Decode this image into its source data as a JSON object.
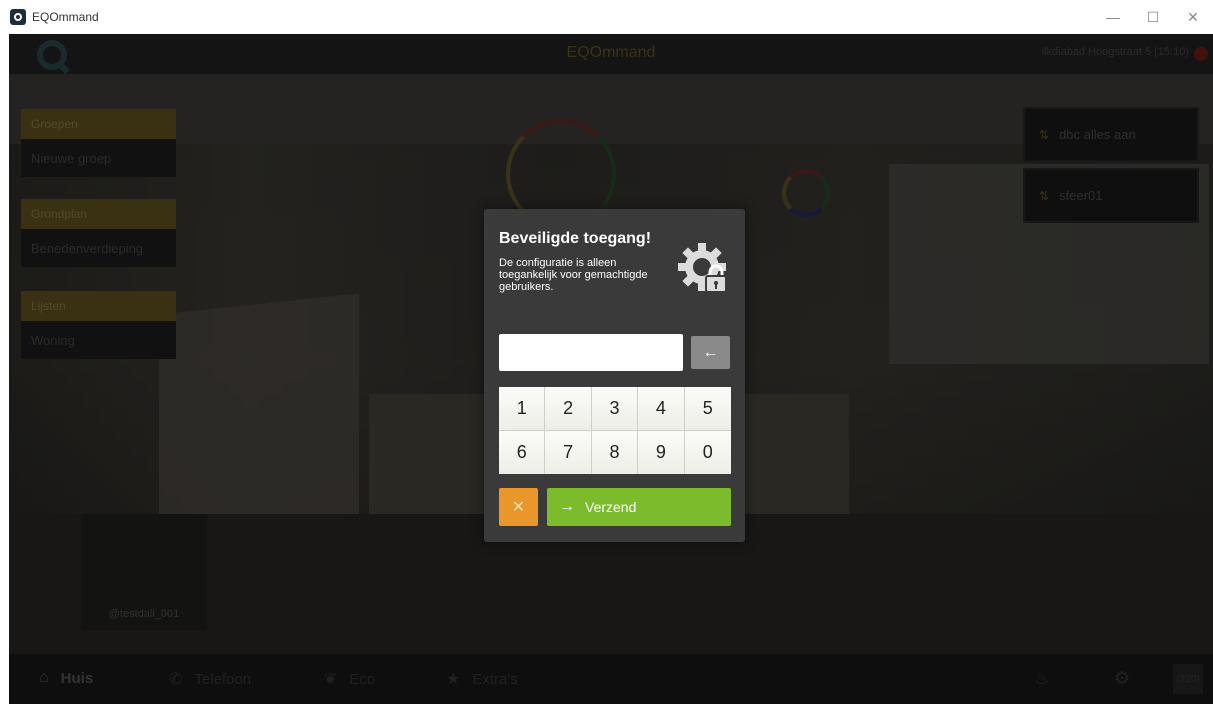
{
  "window": {
    "title": "EQOmmand",
    "controls": {
      "minimize": "—",
      "maximize": "☐",
      "close": "✕"
    }
  },
  "topbar": {
    "app_title": "EQOmmand",
    "status_text": "ilkdiabad Hoogstraat 5 (15:10)",
    "status_color": "#7a1f16"
  },
  "sidebar": {
    "sections": [
      {
        "header": "Groepen",
        "items": [
          "Nieuwe groep"
        ]
      },
      {
        "header": "Grondplan",
        "items": [
          "Benedenverdieping"
        ]
      },
      {
        "header": "Lijsten",
        "items": [
          "Woning"
        ]
      }
    ]
  },
  "scenes": [
    {
      "label": "dbc alles aan",
      "icon": "sliders-icon"
    },
    {
      "label": "sfeer01",
      "icon": "sliders-icon"
    }
  ],
  "avatar": {
    "name": "@testdali_001"
  },
  "bottom_nav": {
    "items": [
      {
        "label": "Huis",
        "icon": "home-icon",
        "active": true
      },
      {
        "label": "Telefoon",
        "icon": "phone-icon",
        "active": false
      },
      {
        "label": "Eco",
        "icon": "leaf-icon",
        "active": false
      },
      {
        "label": "Extra's",
        "icon": "star-icon",
        "active": false
      }
    ],
    "badge": "(220)"
  },
  "dialog": {
    "title": "Beveiligde toegang!",
    "description": "De configuratie is alleen toegankelijk voor gemachtigde gebruikers.",
    "pin_value": "",
    "pin_placeholder": "",
    "backspace_icon": "←",
    "keys": [
      "1",
      "2",
      "3",
      "4",
      "5",
      "6",
      "7",
      "8",
      "9",
      "0"
    ],
    "cancel_icon": "✕",
    "send_label": "Verzend",
    "send_icon": "→",
    "colors": {
      "send": "#7cbc2c",
      "cancel": "#e9962a",
      "dialog_bg": "#3a3a3a"
    }
  }
}
